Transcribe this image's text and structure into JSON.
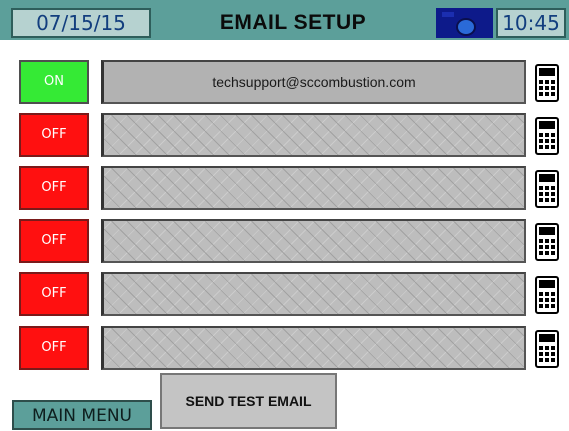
{
  "header": {
    "date": "07/15/15",
    "title": "EMAIL SETUP",
    "time": "10:45"
  },
  "rows": [
    {
      "status": "ON",
      "state": "on",
      "email": "techsupport@sccombustion.com"
    },
    {
      "status": "OFF",
      "state": "off",
      "email": ""
    },
    {
      "status": "OFF",
      "state": "off",
      "email": ""
    },
    {
      "status": "OFF",
      "state": "off",
      "email": ""
    },
    {
      "status": "OFF",
      "state": "off",
      "email": ""
    },
    {
      "status": "OFF",
      "state": "off",
      "email": ""
    }
  ],
  "icons": {
    "camera": "camera-icon",
    "keyboard": "keypad-icon"
  },
  "buttons": {
    "main_menu": "MAIN MENU",
    "send_test": "SEND TEST EMAIL"
  },
  "colors": {
    "header_bg": "#5c9f9a",
    "on": "#35ea35",
    "off": "#ff1010"
  }
}
